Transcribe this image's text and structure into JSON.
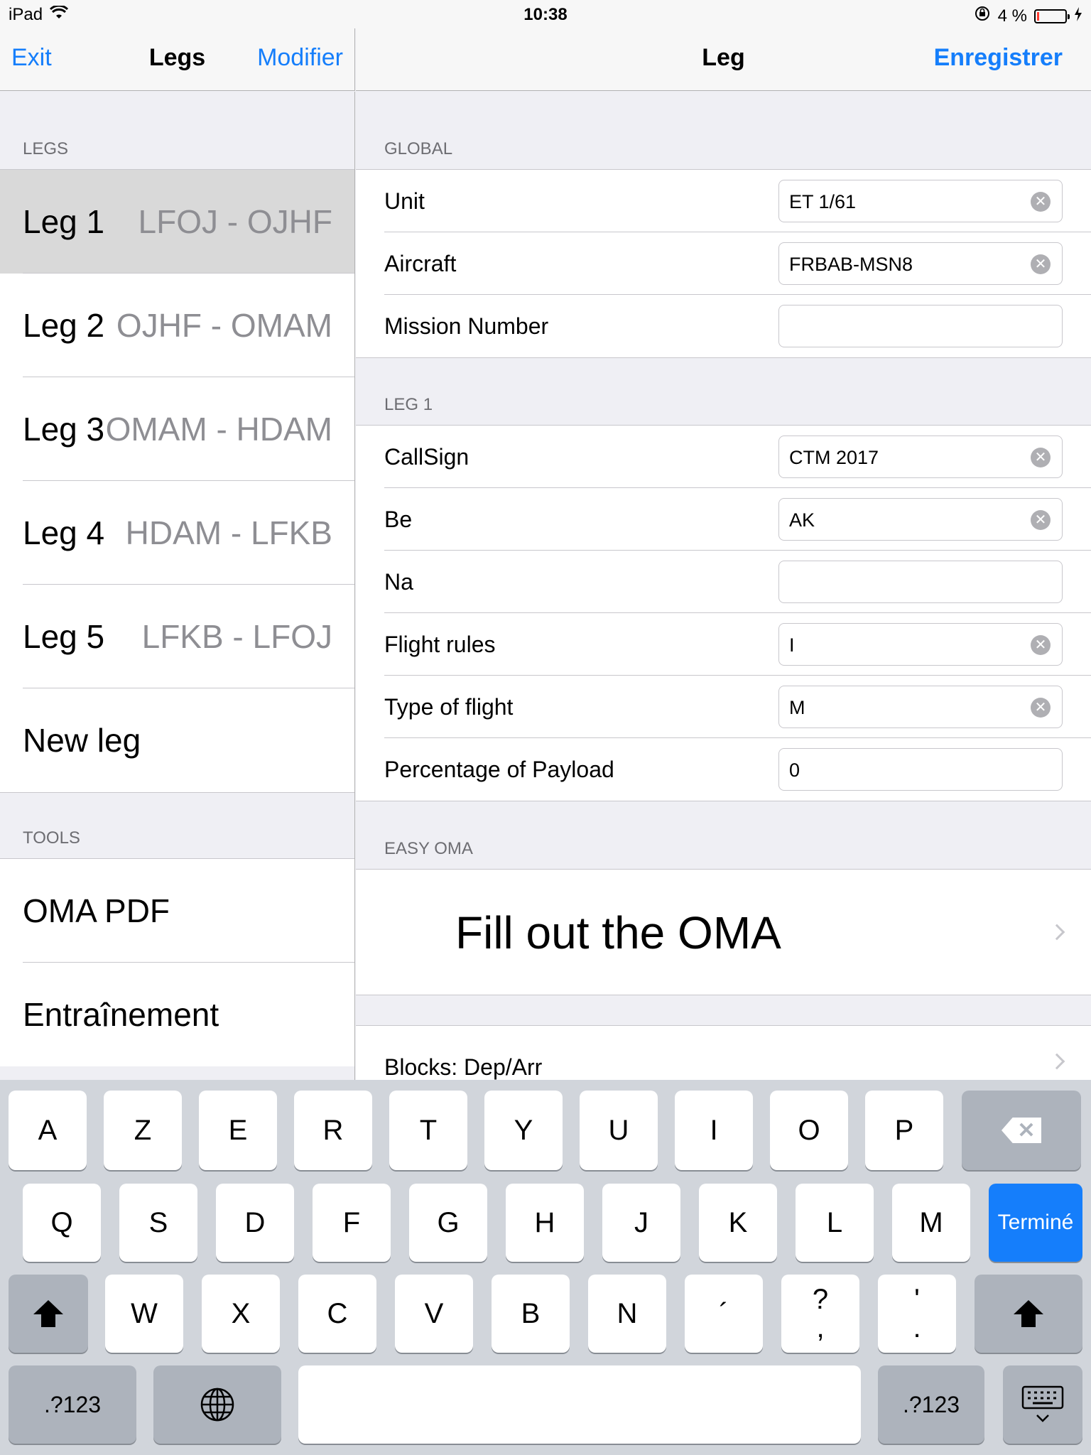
{
  "status": {
    "device": "iPad",
    "time": "10:38",
    "battery": "4 %"
  },
  "nav_left": {
    "back": "Exit",
    "title": "Legs",
    "edit": "Modifier"
  },
  "nav_right": {
    "title": "Leg",
    "save": "Enregistrer"
  },
  "legs_section": "LEGS",
  "legs": [
    {
      "name": "Leg 1",
      "route": "LFOJ - OJHF",
      "selected": true
    },
    {
      "name": "Leg 2",
      "route": "OJHF - OMAM"
    },
    {
      "name": "Leg 3",
      "route": "OMAM - HDAM"
    },
    {
      "name": "Leg 4",
      "route": "HDAM - LFKB"
    },
    {
      "name": "Leg 5",
      "route": "LFKB - LFOJ"
    }
  ],
  "new_leg": "New leg",
  "tools_section": "TOOLS",
  "tools": [
    "OMA PDF",
    "Entraînement"
  ],
  "global_section": "GLOBAL",
  "global_fields": [
    {
      "label": "Unit",
      "value": "ET 1/61",
      "clear": true
    },
    {
      "label": "Aircraft",
      "value": "FRBAB-MSN8",
      "clear": true
    },
    {
      "label": "Mission Number",
      "value": "",
      "clear": false
    }
  ],
  "leg_section": "LEG 1",
  "leg_fields": [
    {
      "label": "CallSign",
      "value": "CTM 2017",
      "clear": true
    },
    {
      "label": "Be",
      "value": "AK",
      "clear": true
    },
    {
      "label": "Na",
      "value": "",
      "clear": false
    },
    {
      "label": "Flight rules",
      "value": "I",
      "clear": true
    },
    {
      "label": "Type of flight",
      "value": "M",
      "clear": true
    },
    {
      "label": "Percentage of Payload",
      "value": "0",
      "clear": false
    }
  ],
  "oma_section": "EASY OMA",
  "oma_action": "Fill out the OMA",
  "blocks_label": "Blocks: Dep/Arr",
  "keyboard": {
    "row1": [
      "A",
      "Z",
      "E",
      "R",
      "T",
      "Y",
      "U",
      "I",
      "O",
      "P"
    ],
    "row2": [
      "Q",
      "S",
      "D",
      "F",
      "G",
      "H",
      "J",
      "K",
      "L",
      "M"
    ],
    "done": "Terminé",
    "row3": [
      "W",
      "X",
      "C",
      "V",
      "B",
      "N",
      "´"
    ],
    "punct1": [
      "?",
      ","
    ],
    "punct2": [
      "'",
      "."
    ],
    "numbers": ".?123"
  },
  "colors": {
    "accent": "#157efb",
    "selected": "#d9d9d9",
    "keyboard_bg": "#d1d5db"
  }
}
